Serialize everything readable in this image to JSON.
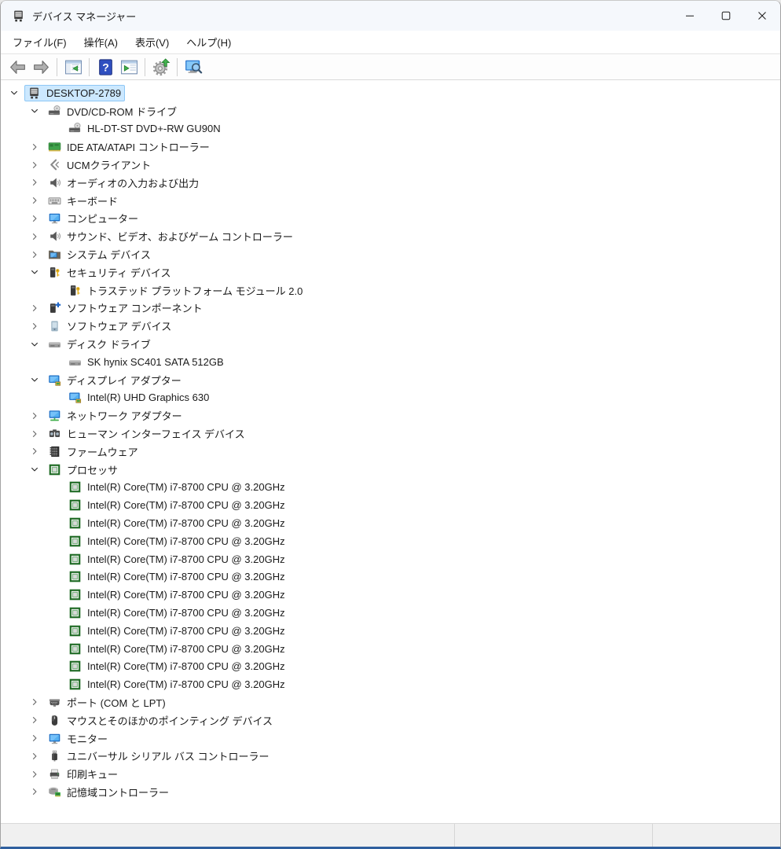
{
  "window": {
    "title": "デバイス マネージャー"
  },
  "titlebar_controls": [
    {
      "name": "minimize-button",
      "icon": "minimize-icon"
    },
    {
      "name": "maximize-button",
      "icon": "maximize-icon"
    },
    {
      "name": "close-button",
      "icon": "close-icon"
    }
  ],
  "menu": {
    "items": [
      {
        "name": "menu-file",
        "label": "ファイル(F)"
      },
      {
        "name": "menu-action",
        "label": "操作(A)"
      },
      {
        "name": "menu-view",
        "label": "表示(V)"
      },
      {
        "name": "menu-help",
        "label": "ヘルプ(H)"
      }
    ]
  },
  "toolbar": {
    "buttons": [
      {
        "name": "back-button",
        "icon": "back-arrow-icon"
      },
      {
        "name": "forward-button",
        "icon": "forward-arrow-icon"
      },
      {
        "separator": true
      },
      {
        "name": "show-console-tree-button",
        "icon": "console-tree-icon"
      },
      {
        "separator": true
      },
      {
        "name": "help-button",
        "icon": "help-icon"
      },
      {
        "name": "action-pane-button",
        "icon": "action-pane-icon"
      },
      {
        "separator": true
      },
      {
        "name": "scan-hardware-changes-button",
        "icon": "scan-hardware-changes-icon"
      },
      {
        "separator": true
      },
      {
        "name": "device-manager-view-button",
        "icon": "device-manager-icon"
      }
    ]
  },
  "tree": {
    "items": [
      {
        "label": "DESKTOP-2789",
        "level": 0,
        "state": "expanded",
        "icon": "computer-icon",
        "selected": true
      },
      {
        "label": "DVD/CD-ROM ドライブ",
        "level": 1,
        "state": "expanded",
        "icon": "dvd-drive-icon"
      },
      {
        "label": "HL-DT-ST DVD+-RW GU90N",
        "level": 2,
        "state": "leaf",
        "icon": "dvd-drive-icon"
      },
      {
        "label": "IDE ATA/ATAPI コントローラー",
        "level": 1,
        "state": "collapsed",
        "icon": "ide-controller-icon"
      },
      {
        "label": "UCMクライアント",
        "level": 1,
        "state": "collapsed",
        "icon": "ucm-client-icon"
      },
      {
        "label": "オーディオの入力および出力",
        "level": 1,
        "state": "collapsed",
        "icon": "audio-io-icon"
      },
      {
        "label": "キーボード",
        "level": 1,
        "state": "collapsed",
        "icon": "keyboard-icon"
      },
      {
        "label": "コンピューター",
        "level": 1,
        "state": "collapsed",
        "icon": "computer-monitor-icon"
      },
      {
        "label": "サウンド、ビデオ、およびゲーム コントローラー",
        "level": 1,
        "state": "collapsed",
        "icon": "sound-controller-icon"
      },
      {
        "label": "システム デバイス",
        "level": 1,
        "state": "collapsed",
        "icon": "system-device-icon"
      },
      {
        "label": "セキュリティ デバイス",
        "level": 1,
        "state": "expanded",
        "icon": "security-device-icon"
      },
      {
        "label": "トラステッド プラットフォーム モジュール 2.0",
        "level": 2,
        "state": "leaf",
        "icon": "security-device-icon"
      },
      {
        "label": "ソフトウェア コンポーネント",
        "level": 1,
        "state": "collapsed",
        "icon": "software-component-icon"
      },
      {
        "label": "ソフトウェア デバイス",
        "level": 1,
        "state": "collapsed",
        "icon": "software-device-icon"
      },
      {
        "label": "ディスク ドライブ",
        "level": 1,
        "state": "expanded",
        "icon": "disk-drive-icon"
      },
      {
        "label": "SK hynix SC401 SATA 512GB",
        "level": 2,
        "state": "leaf",
        "icon": "disk-drive-icon"
      },
      {
        "label": "ディスプレイ アダプター",
        "level": 1,
        "state": "expanded",
        "icon": "display-adapter-icon"
      },
      {
        "label": "Intel(R) UHD Graphics 630",
        "level": 2,
        "state": "leaf",
        "icon": "display-adapter-icon"
      },
      {
        "label": "ネットワーク アダプター",
        "level": 1,
        "state": "collapsed",
        "icon": "network-adapter-icon"
      },
      {
        "label": "ヒューマン インターフェイス デバイス",
        "level": 1,
        "state": "collapsed",
        "icon": "hid-icon"
      },
      {
        "label": "ファームウェア",
        "level": 1,
        "state": "collapsed",
        "icon": "firmware-icon"
      },
      {
        "label": "プロセッサ",
        "level": 1,
        "state": "expanded",
        "icon": "processor-icon"
      },
      {
        "label": "Intel(R) Core(TM) i7-8700 CPU @ 3.20GHz",
        "level": 2,
        "state": "leaf",
        "icon": "processor-icon"
      },
      {
        "label": "Intel(R) Core(TM) i7-8700 CPU @ 3.20GHz",
        "level": 2,
        "state": "leaf",
        "icon": "processor-icon"
      },
      {
        "label": "Intel(R) Core(TM) i7-8700 CPU @ 3.20GHz",
        "level": 2,
        "state": "leaf",
        "icon": "processor-icon"
      },
      {
        "label": "Intel(R) Core(TM) i7-8700 CPU @ 3.20GHz",
        "level": 2,
        "state": "leaf",
        "icon": "processor-icon"
      },
      {
        "label": "Intel(R) Core(TM) i7-8700 CPU @ 3.20GHz",
        "level": 2,
        "state": "leaf",
        "icon": "processor-icon"
      },
      {
        "label": "Intel(R) Core(TM) i7-8700 CPU @ 3.20GHz",
        "level": 2,
        "state": "leaf",
        "icon": "processor-icon"
      },
      {
        "label": "Intel(R) Core(TM) i7-8700 CPU @ 3.20GHz",
        "level": 2,
        "state": "leaf",
        "icon": "processor-icon"
      },
      {
        "label": "Intel(R) Core(TM) i7-8700 CPU @ 3.20GHz",
        "level": 2,
        "state": "leaf",
        "icon": "processor-icon"
      },
      {
        "label": "Intel(R) Core(TM) i7-8700 CPU @ 3.20GHz",
        "level": 2,
        "state": "leaf",
        "icon": "processor-icon"
      },
      {
        "label": "Intel(R) Core(TM) i7-8700 CPU @ 3.20GHz",
        "level": 2,
        "state": "leaf",
        "icon": "processor-icon"
      },
      {
        "label": "Intel(R) Core(TM) i7-8700 CPU @ 3.20GHz",
        "level": 2,
        "state": "leaf",
        "icon": "processor-icon"
      },
      {
        "label": "Intel(R) Core(TM) i7-8700 CPU @ 3.20GHz",
        "level": 2,
        "state": "leaf",
        "icon": "processor-icon"
      },
      {
        "label": "ポート (COM と LPT)",
        "level": 1,
        "state": "collapsed",
        "icon": "port-icon"
      },
      {
        "label": "マウスとそのほかのポインティング デバイス",
        "level": 1,
        "state": "collapsed",
        "icon": "mouse-icon"
      },
      {
        "label": "モニター",
        "level": 1,
        "state": "collapsed",
        "icon": "monitor-icon"
      },
      {
        "label": "ユニバーサル シリアル バス コントローラー",
        "level": 1,
        "state": "collapsed",
        "icon": "usb-icon"
      },
      {
        "label": "印刷キュー",
        "level": 1,
        "state": "collapsed",
        "icon": "print-queue-icon"
      },
      {
        "label": "記憶域コントローラー",
        "level": 1,
        "state": "collapsed",
        "icon": "storage-controller-icon"
      }
    ]
  },
  "statusbar": {
    "panes": [
      "",
      "",
      ""
    ]
  },
  "colors": {
    "selection_bg": "#cce8ff",
    "selection_border": "#8ec7f5",
    "accent_green": "#44b04e",
    "help_blue": "#2f4fc0",
    "processor_green": "#1e6b24",
    "window_bottom_border": "#2f5f9e"
  }
}
